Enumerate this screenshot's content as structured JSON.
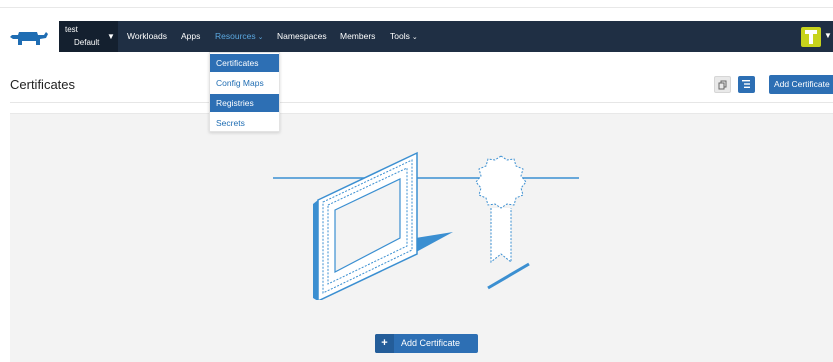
{
  "header": {
    "project": "test",
    "namespace": "Default",
    "nav": [
      {
        "label": "Workloads",
        "has_caret": false
      },
      {
        "label": "Apps",
        "has_caret": false
      },
      {
        "label": "Resources",
        "has_caret": true,
        "active": true
      },
      {
        "label": "Namespaces",
        "has_caret": false
      },
      {
        "label": "Members",
        "has_caret": false
      },
      {
        "label": "Tools",
        "has_caret": true
      }
    ],
    "caret_glyph": "⌄",
    "avatar_icon": "user-avatar-icon"
  },
  "resources_menu": {
    "items": [
      {
        "label": "Certificates",
        "highlighted": true
      },
      {
        "label": "Config Maps",
        "highlighted": false
      },
      {
        "label": "Registries",
        "highlighted": true
      },
      {
        "label": "Secrets",
        "highlighted": false
      }
    ]
  },
  "page": {
    "title": "Certificates",
    "add_top_label": "Add Certificate",
    "empty_add_label": "Add Certificate",
    "plus_glyph": "+"
  },
  "colors": {
    "nav_bg": "#1f2f44",
    "context_bg": "#14202f",
    "accent": "#2d6fb4",
    "active_nav": "#5ba8e0",
    "avatar": "#c7d31c",
    "empty_bg": "#f3f3f3"
  }
}
